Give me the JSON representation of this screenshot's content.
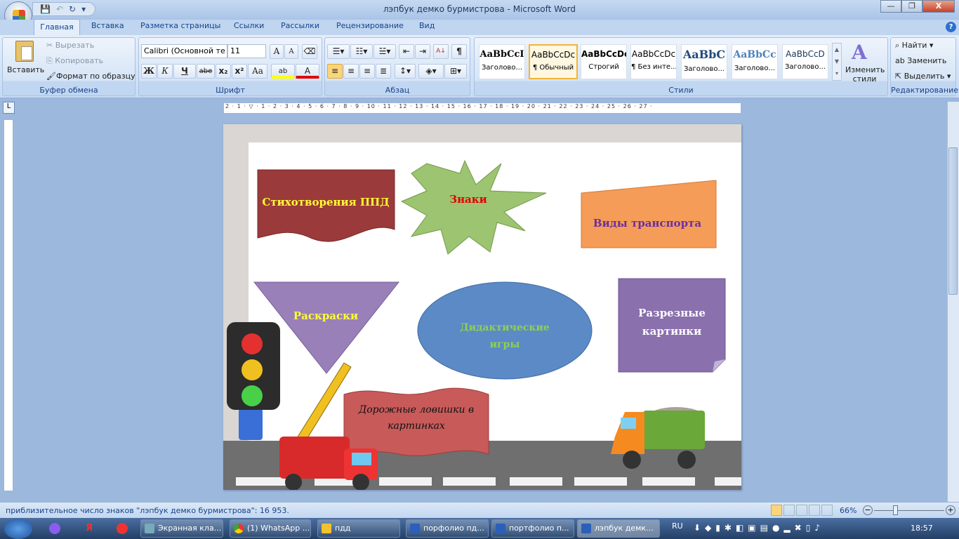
{
  "window": {
    "title": "лэпбук  демко бурмистрова - Microsoft Word",
    "min": "—",
    "restore": "❐",
    "close": "X"
  },
  "qat": {
    "save": "💾",
    "undo": "↶",
    "redo": "↻",
    "more": "▾"
  },
  "tabs": [
    "Главная",
    "Вставка",
    "Разметка страницы",
    "Ссылки",
    "Рассылки",
    "Рецензирование",
    "Вид"
  ],
  "help": "?",
  "clipboard": {
    "paste": "Вставить",
    "cut": "Вырезать",
    "copy": "Копировать",
    "format_painter": "Формат по образцу",
    "label": "Буфер обмена"
  },
  "font": {
    "name": "Calibri (Основной те",
    "size": "11",
    "bold": "Ж",
    "italic": "К",
    "underline": "Ч",
    "strike": "abe",
    "sub": "x₂",
    "sup": "x²",
    "case": "Aa",
    "grow": "A",
    "shrink": "A",
    "highlight": "ab",
    "color": "A",
    "label": "Шрифт",
    "highlight_color": "#ffff00",
    "font_color": "#e00000"
  },
  "paragraph": {
    "label": "Абзац",
    "show_marks": "¶",
    "sort": "А↓"
  },
  "styles": {
    "label": "Стили",
    "items": [
      {
        "preview": "AaBbCcI",
        "name": "Заголово..."
      },
      {
        "preview": "AaBbCcDc",
        "name": "¶ Обычный",
        "selected": true
      },
      {
        "preview": "AaBbCcDc",
        "name": "Строгий"
      },
      {
        "preview": "AaBbCcDc",
        "name": "¶ Без инте..."
      },
      {
        "preview": "AaBbC",
        "name": "Заголово..."
      },
      {
        "preview": "AaBbCc",
        "name": "Заголово..."
      },
      {
        "preview": "AaBbCcD",
        "name": "Заголово..."
      }
    ],
    "change": "Изменить стили"
  },
  "editing": {
    "find": "Найти",
    "replace": "Заменить",
    "select": "Выделить",
    "label": "Редактирование"
  },
  "ruler": "2 · 1 · ▽ · 1 · 2 · 3 · 4 · 5 · 6 · 7 · 8 · 9 · 10 · 11 · 12 · 13 · 14 · 15 · 16 · 17 · 18 · 19 · 20 · 21 · 22 · 23 · 24 · 25 · 26 · 27 ·",
  "document": {
    "shapes": {
      "poems": "Стихотворения ППД",
      "signs": "Знаки",
      "transport": "Виды транспорта",
      "coloring": "Раскраски",
      "games1": "Дидактические",
      "games2": "игры",
      "cut1": "Разрезные",
      "cut2": "картинки",
      "traps1": "Дорожные ловишки в",
      "traps2": "картинках"
    }
  },
  "status": {
    "text": "приблизительное число знаков \"лэпбук  демко бурмистрова\": 16 953.",
    "zoom": "66%",
    "zoom_level": 66
  },
  "taskbar": {
    "items": [
      "Экранная кла...",
      "(1) WhatsApp ...",
      "пдд",
      "порфолио пд...",
      "портфолио п...",
      "лэпбук  демк..."
    ],
    "lang": "RU",
    "time": "18:57"
  }
}
